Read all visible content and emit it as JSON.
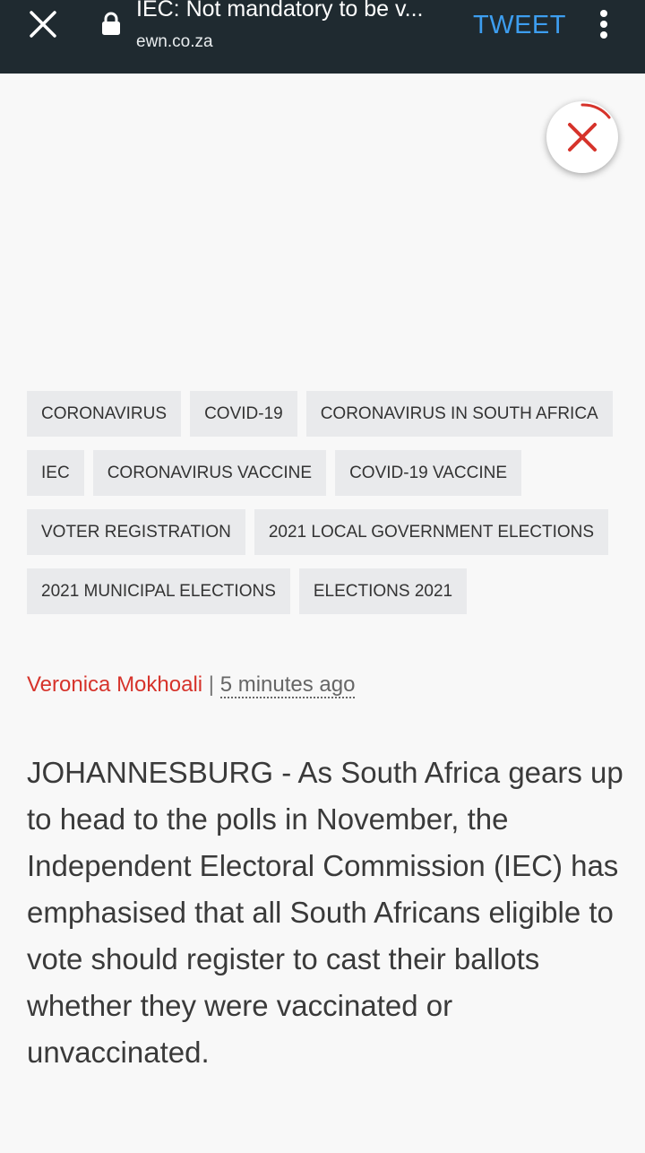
{
  "browser_bar": {
    "page_title": "IEC: Not mandatory to be v...",
    "domain": "ewn.co.za",
    "tweet_label": "TWEET"
  },
  "tags": [
    [
      "CORONAVIRUS",
      "COVID-19",
      "CORONAVIRUS IN SOUTH AFRICA"
    ],
    [
      "IEC",
      "CORONAVIRUS VACCINE",
      "COVID-19 VACCINE"
    ],
    [
      "VOTER REGISTRATION",
      "2021 LOCAL GOVERNMENT ELECTIONS"
    ],
    [
      "2021 MUNICIPAL ELECTIONS",
      "ELECTIONS 2021"
    ]
  ],
  "byline": {
    "author": "Veronica Mokhoali",
    "separator": "|",
    "time": "5 minutes ago"
  },
  "article": {
    "lead": "JOHANNESBURG - As South Africa gears up to head to the polls in November, the Independent Electoral Commission (IEC) has emphasised that all South Africans eligible to vote should register to cast their ballots whether they were vaccinated or unvaccinated."
  },
  "colors": {
    "topbar": "#1f2a30",
    "tweet": "#3d9ef0",
    "author": "#d6332b",
    "ad_close": "#d6332b",
    "tag_bg": "#e9eaec"
  },
  "icons": {
    "close": "close-icon",
    "lock": "lock-icon",
    "menu": "more-vertical-icon",
    "ad_close": "close-icon"
  }
}
